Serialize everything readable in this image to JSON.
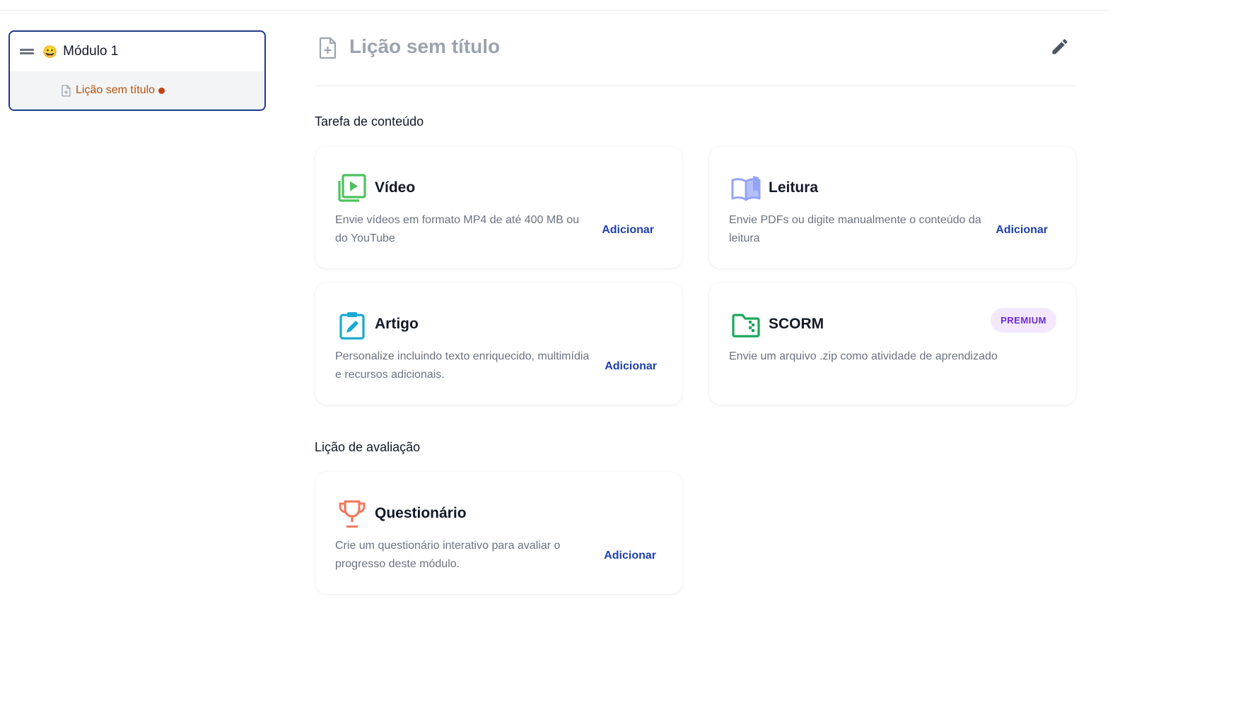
{
  "sidebar": {
    "module": {
      "emoji": "😀",
      "title": "Módulo 1"
    },
    "lesson": {
      "label": "Lição sem título"
    }
  },
  "lesson": {
    "title": "Lição sem título"
  },
  "sections": {
    "content": {
      "title": "Tarefa de conteúdo",
      "cards": {
        "video": {
          "title": "Vídeo",
          "description": "Envie vídeos em formato MP4 de até 400 MB ou do YouTube",
          "action": "Adicionar",
          "icon": "video-play-icon",
          "color": "#4cc25c"
        },
        "reading": {
          "title": "Leitura",
          "description": "Envie PDFs ou digite manualmente o conteúdo da leitura",
          "action": "Adicionar",
          "icon": "open-book-icon",
          "color": "#93a3f8"
        },
        "article": {
          "title": "Artigo",
          "description": "Personalize incluindo texto enriquecido, multimídia e recursos adicionais.",
          "action": "Adicionar",
          "icon": "clipboard-edit-icon",
          "color": "#1aa9d1"
        },
        "scorm": {
          "title": "SCORM",
          "description": "Envie um arquivo .zip como atividade de aprendizado",
          "badge": "PREMIUM",
          "icon": "zip-folder-icon",
          "color": "#1aa85a"
        }
      }
    },
    "assessment": {
      "title": "Lição de avaliação",
      "cards": {
        "quiz": {
          "title": "Questionário",
          "description": "Crie um questionário interativo para avaliar o progresso deste módulo.",
          "action": "Adicionar",
          "icon": "trophy-icon",
          "color": "#f07a5e"
        }
      }
    }
  },
  "colors": {
    "accent": "#1e40af",
    "sidebar_border": "#1e3a8a",
    "unsaved": "#c2410c",
    "lesson_link": "#b45309",
    "premium_bg": "#f3e8ff",
    "premium_text": "#6d28d9"
  }
}
